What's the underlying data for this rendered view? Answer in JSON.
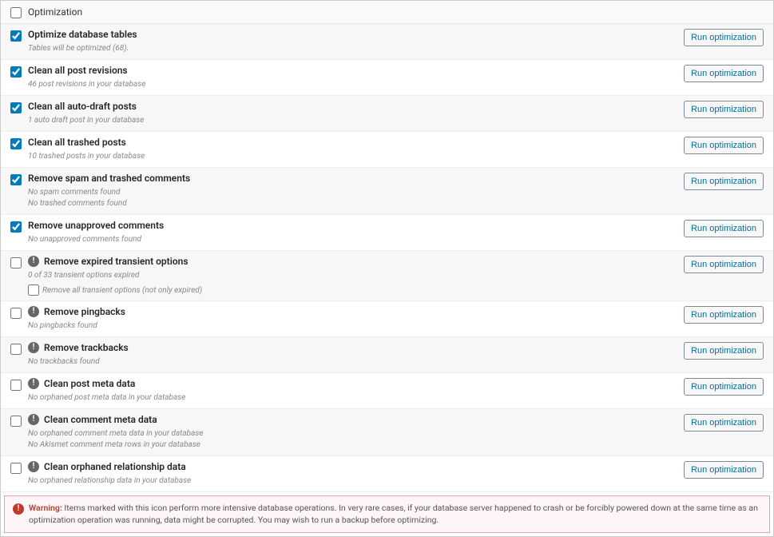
{
  "header": {
    "title": "Optimization"
  },
  "button_label": "Run optimization",
  "sub_checkbox_label": "Remove all transient options (not only expired)",
  "rows": [
    {
      "checked": true,
      "warn": false,
      "title": "Optimize database tables",
      "desc": [
        "Tables will be optimized (68)."
      ]
    },
    {
      "checked": true,
      "warn": false,
      "title": "Clean all post revisions",
      "desc": [
        "46 post revisions in your database"
      ]
    },
    {
      "checked": true,
      "warn": false,
      "title": "Clean all auto-draft posts",
      "desc": [
        "1 auto draft post in your database"
      ]
    },
    {
      "checked": true,
      "warn": false,
      "title": "Clean all trashed posts",
      "desc": [
        "10 trashed posts in your database"
      ]
    },
    {
      "checked": true,
      "warn": false,
      "title": "Remove spam and trashed comments",
      "desc": [
        "No spam comments found",
        "No trashed comments found"
      ]
    },
    {
      "checked": true,
      "warn": false,
      "title": "Remove unapproved comments",
      "desc": [
        "No unapproved comments found"
      ]
    },
    {
      "checked": false,
      "warn": true,
      "title": "Remove expired transient options",
      "desc": [
        "0 of 33 transient options expired"
      ],
      "sub_checkbox": true
    },
    {
      "checked": false,
      "warn": true,
      "title": "Remove pingbacks",
      "desc": [
        "No pingbacks found"
      ]
    },
    {
      "checked": false,
      "warn": true,
      "title": "Remove trackbacks",
      "desc": [
        "No trackbacks found"
      ]
    },
    {
      "checked": false,
      "warn": true,
      "title": "Clean post meta data",
      "desc": [
        "No orphaned post meta data in your database"
      ]
    },
    {
      "checked": false,
      "warn": true,
      "title": "Clean comment meta data",
      "desc": [
        "No orphaned comment meta data in your database",
        "No Akismet comment meta rows in your database"
      ]
    },
    {
      "checked": false,
      "warn": true,
      "title": "Clean orphaned relationship data",
      "desc": [
        "No orphaned relationship data in your database"
      ]
    }
  ],
  "warning": {
    "label": "Warning:",
    "text": "Items marked with this icon perform more intensive database operations. In very rare cases, if your database server happened to crash or be forcibly powered down at the same time as an optimization operation was running, data might be corrupted. You may wish to run a backup before optimizing."
  }
}
